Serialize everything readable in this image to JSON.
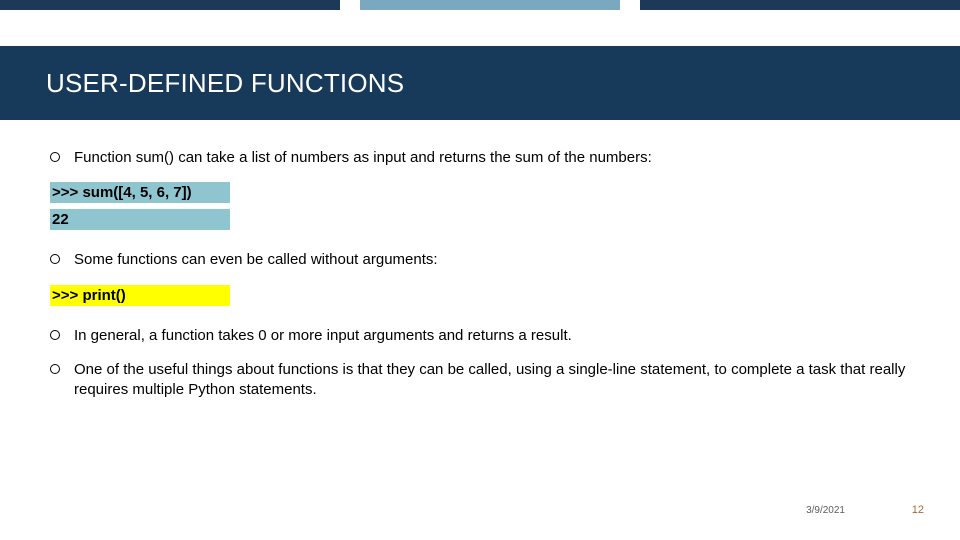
{
  "title": "USER-DEFINED FUNCTIONS",
  "bullets": {
    "b1": "Function sum() can take a list of numbers as input and returns the sum of the numbers:",
    "b2": "Some functions can even be called without arguments:",
    "b3": "In general, a function takes 0 or more input arguments and returns a result.",
    "b4": "One of the useful things about functions is that they can be called, using a single-line statement, to complete a task that really requires multiple Python statements."
  },
  "code1": {
    "line1": ">>> sum([4, 5, 6, 7])",
    "line2": "22"
  },
  "code2": {
    "line1": ">>> print()"
  },
  "footer": {
    "date": "3/9/2021",
    "page": "12"
  }
}
